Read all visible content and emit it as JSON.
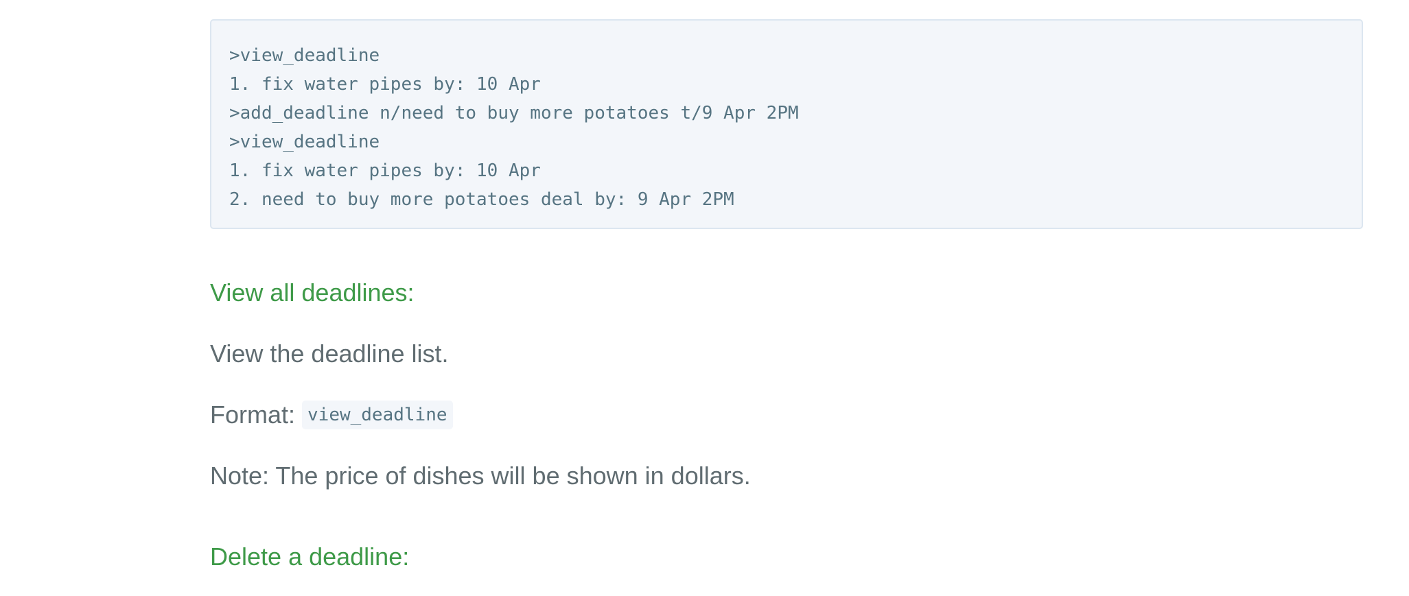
{
  "code_block": {
    "lines": [
      ">view_deadline",
      "1. fix water pipes by: 10 Apr",
      ">add_deadline n/need to buy more potatoes t/9 Apr 2PM",
      ">view_deadline",
      "1. fix water pipes by: 10 Apr",
      "2. need to buy more potatoes deal by: 9 Apr 2PM"
    ]
  },
  "sections": {
    "view_all": {
      "heading": "View all deadlines:",
      "description": "View the deadline list.",
      "format_label": "Format: ",
      "format_code": "view_deadline",
      "note": "Note: The price of dishes will be shown in dollars."
    },
    "delete": {
      "heading": "Delete a deadline:"
    }
  },
  "colors": {
    "heading": "#3e9a48",
    "text": "#606c71",
    "code_bg": "#f3f6fa",
    "code_border": "#dce6f0",
    "code_text": "#567482"
  }
}
